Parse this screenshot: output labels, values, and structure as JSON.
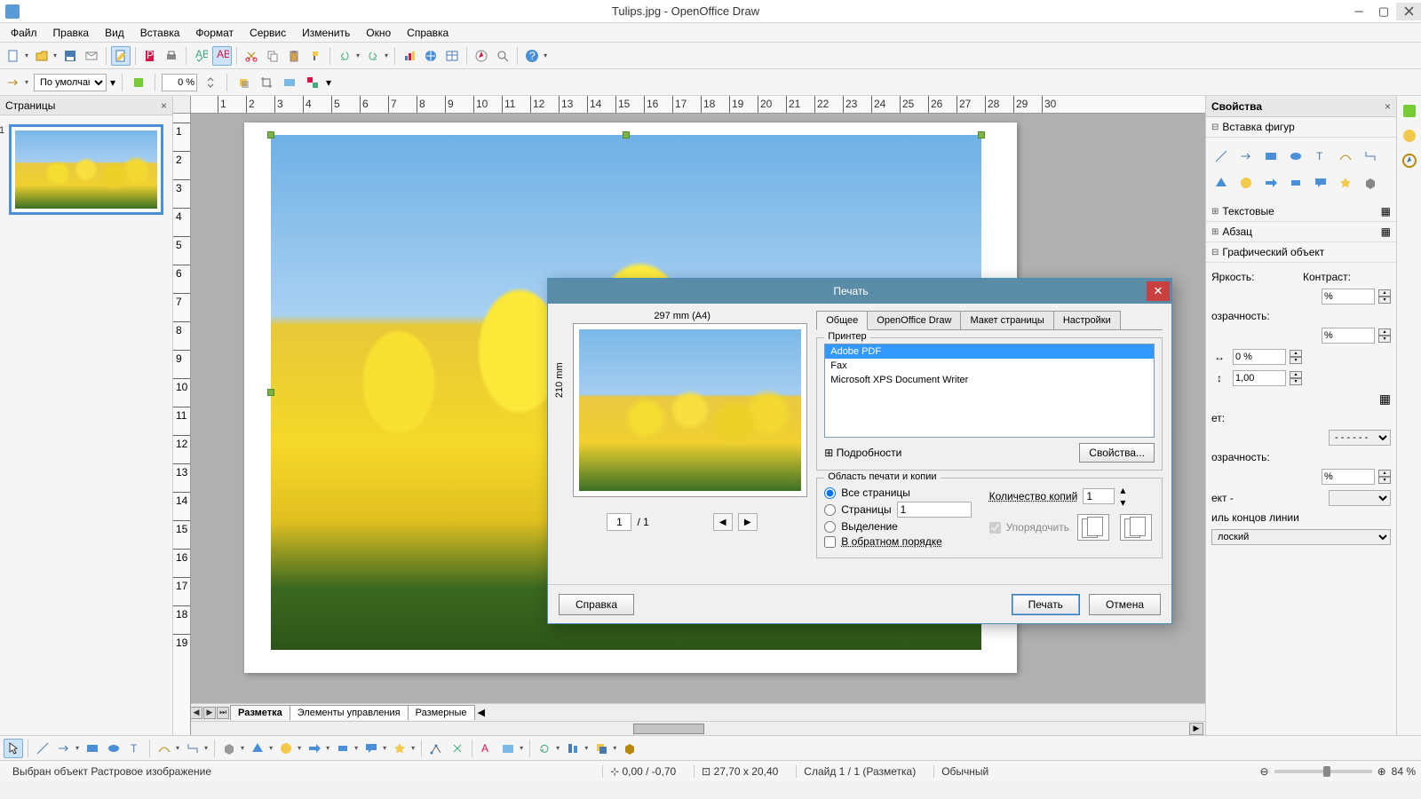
{
  "titlebar": {
    "title": "Tulips.jpg - OpenOffice Draw"
  },
  "menu": [
    "Файл",
    "Правка",
    "Вид",
    "Вставка",
    "Формат",
    "Сервис",
    "Изменить",
    "Окно",
    "Справка"
  ],
  "style_selector": {
    "value": "По умолчанию",
    "zoom_value": "0 %"
  },
  "ruler_h": [
    1,
    2,
    3,
    4,
    5,
    6,
    7,
    8,
    9,
    10,
    11,
    12,
    13,
    14,
    15,
    16,
    17,
    18,
    19,
    20,
    21,
    22,
    23,
    24,
    25,
    26,
    27,
    28,
    29,
    30
  ],
  "ruler_v": [
    1,
    2,
    3,
    4,
    5,
    6,
    7,
    8,
    9,
    10,
    11,
    12,
    13,
    14,
    15,
    16,
    17,
    18,
    19
  ],
  "pages_panel": {
    "title": "Страницы",
    "page_num": "1"
  },
  "sheet_tabs": {
    "tabs": [
      "Разметка",
      "Элементы управления",
      "Размерные"
    ]
  },
  "props": {
    "title": "Свойства",
    "sections": {
      "shapes": "Вставка фигур",
      "text": "Текстовые",
      "para": "Абзац",
      "graphic": "Графический объект"
    },
    "brightness": "Яркость:",
    "contrast": "Контраст:",
    "pct": "%",
    "transparency": "озрачность:",
    "zero_pct": "0 %",
    "one": "1,00",
    "color": "ет:",
    "transp2": "озрачность:",
    "style": "иль концов линии",
    "flat": "лоский",
    "dash": "- - - - - -",
    "effect": "ект -"
  },
  "dialog": {
    "title": "Печать",
    "tabs": [
      "Общее",
      "OpenOffice Draw",
      "Макет страницы",
      "Настройки"
    ],
    "printer_legend": "Принтер",
    "printers": [
      "Adobe PDF",
      "Fax",
      "Microsoft XPS Document Writer"
    ],
    "details": "Подробности",
    "props_btn": "Свойства...",
    "range_legend": "Область печати и копии",
    "all_pages": "Все страницы",
    "pages": "Страницы",
    "pages_val": "1",
    "selection": "Выделение",
    "reverse": "В обратном порядке",
    "copies": "Количество копий",
    "copies_val": "1",
    "collate": "Упорядочить",
    "preview_top": "297 mm (A4)",
    "preview_side": "210 mm",
    "page_in": "1",
    "page_of": "/ 1",
    "help": "Справка",
    "print": "Печать",
    "cancel": "Отмена"
  },
  "status": {
    "selected": "Выбран объект Растровое изображение",
    "coords": "0,00 / -0,70",
    "size": "27,70 x 20,40",
    "slide": "Слайд 1 / 1 (Разметка)",
    "mode": "Обычный",
    "zoom": "84 %"
  }
}
